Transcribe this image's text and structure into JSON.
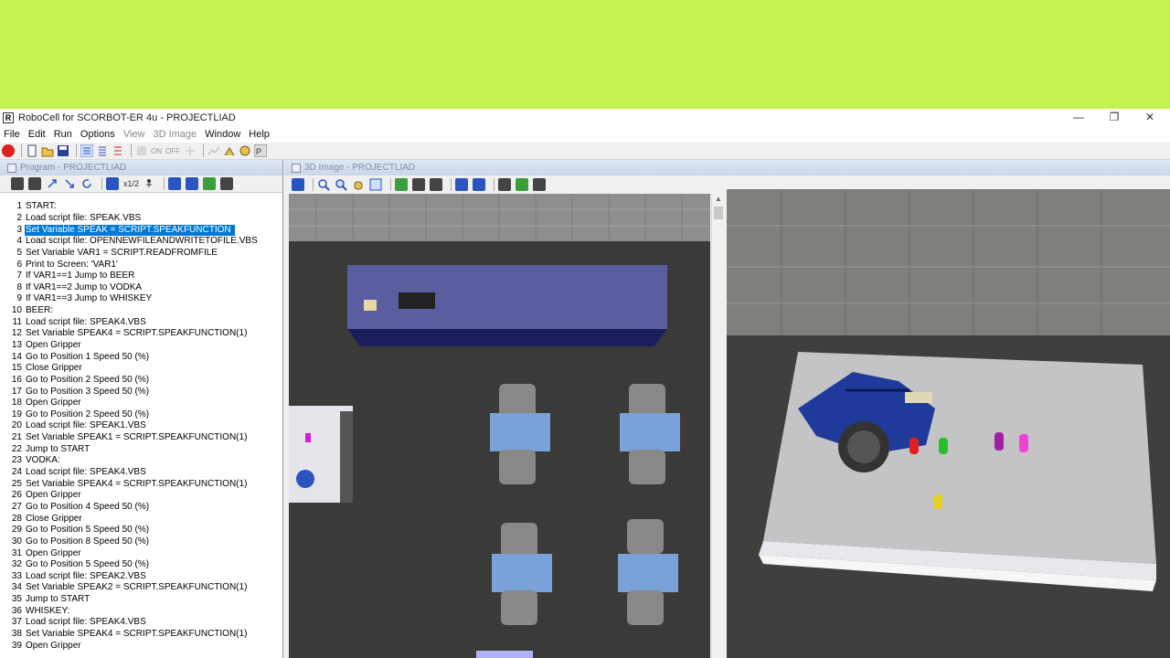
{
  "window": {
    "title": "RoboCell for SCORBOT-ER 4u - PROJECTLIAD",
    "minimize": "—",
    "restore": "❐",
    "close": "✕"
  },
  "menu": {
    "items": [
      "File",
      "Edit",
      "Run",
      "Options",
      "View",
      "3D Image",
      "Window",
      "Help"
    ]
  },
  "toolbar": {
    "on_label": "ON",
    "off_label": "OFF"
  },
  "program_panel": {
    "title": "Program - PROJECTLIAD",
    "speed_label": "x1/2",
    "selected_line": 3,
    "lines": [
      {
        "n": "1",
        "t": "START:"
      },
      {
        "n": "2",
        "t": "Load script file: SPEAK.VBS"
      },
      {
        "n": "3",
        "t": "Set Variable SPEAK  = SCRIPT.SPEAKFUNCTION"
      },
      {
        "n": "4",
        "t": "Load script file: OPENNEWFILEANDWRITETOFILE.VBS"
      },
      {
        "n": "5",
        "t": "Set Variable VAR1  = SCRIPT.READFROMFILE"
      },
      {
        "n": "6",
        "t": "Print to Screen: 'VAR1'"
      },
      {
        "n": "7",
        "t": "If VAR1==1 Jump to BEER"
      },
      {
        "n": "8",
        "t": "If VAR1==2 Jump to VODKA"
      },
      {
        "n": "9",
        "t": "If VAR1==3 Jump to WHISKEY"
      },
      {
        "n": "10",
        "t": "BEER:"
      },
      {
        "n": "11",
        "t": "Load script file: SPEAK4.VBS"
      },
      {
        "n": "12",
        "t": "Set Variable SPEAK4  = SCRIPT.SPEAKFUNCTION(1)"
      },
      {
        "n": "13",
        "t": "Open Gripper"
      },
      {
        "n": "14",
        "t": "Go to Position 1 Speed 50 (%)"
      },
      {
        "n": "15",
        "t": "Close Gripper"
      },
      {
        "n": "16",
        "t": "Go to Position 2 Speed 50 (%)"
      },
      {
        "n": "17",
        "t": "Go to Position 3 Speed 50 (%)"
      },
      {
        "n": "18",
        "t": "Open Gripper"
      },
      {
        "n": "19",
        "t": "Go to Position 2 Speed 50 (%)"
      },
      {
        "n": "20",
        "t": "Load script file: SPEAK1.VBS"
      },
      {
        "n": "21",
        "t": "Set Variable SPEAK1  = SCRIPT.SPEAKFUNCTION(1)"
      },
      {
        "n": "22",
        "t": "Jump to START"
      },
      {
        "n": "23",
        "t": "VODKA:"
      },
      {
        "n": "24",
        "t": "Load script file: SPEAK4.VBS"
      },
      {
        "n": "25",
        "t": "Set Variable SPEAK4  = SCRIPT.SPEAKFUNCTION(1)"
      },
      {
        "n": "26",
        "t": "Open Gripper"
      },
      {
        "n": "27",
        "t": "Go to Position 4 Speed 50 (%)"
      },
      {
        "n": "28",
        "t": "Close Gripper"
      },
      {
        "n": "29",
        "t": "Go to Position 5 Speed 50 (%)"
      },
      {
        "n": "30",
        "t": "Go to Position 8 Speed 50 (%)"
      },
      {
        "n": "31",
        "t": "Open Gripper"
      },
      {
        "n": "32",
        "t": "Go to Position 5 Speed 50 (%)"
      },
      {
        "n": "33",
        "t": "Load script file: SPEAK2.VBS"
      },
      {
        "n": "34",
        "t": "Set Variable SPEAK2  = SCRIPT.SPEAKFUNCTION(1)"
      },
      {
        "n": "35",
        "t": "Jump to START"
      },
      {
        "n": "36",
        "t": "WHISKEY:"
      },
      {
        "n": "37",
        "t": "Load script file: SPEAK4.VBS"
      },
      {
        "n": "38",
        "t": "Set Variable SPEAK4  = SCRIPT.SPEAKFUNCTION(1)"
      },
      {
        "n": "39",
        "t": "Open Gripper"
      }
    ]
  },
  "view3d": {
    "title": "3D Image - PROJECTLIAD"
  },
  "colors": {
    "accent_selection": "#0078d7",
    "background_band": "#c4f24f"
  }
}
